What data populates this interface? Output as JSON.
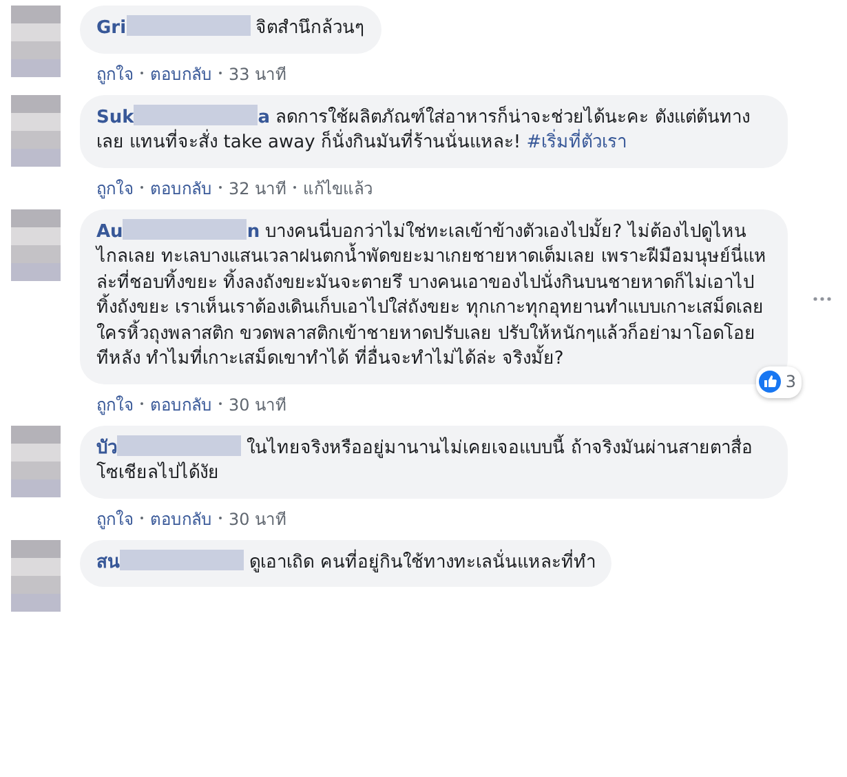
{
  "comments": [
    {
      "name": "Gri",
      "text": "จิตสำนึกล้วนๆ",
      "meta": [
        "ถูกใจ",
        "ตอบกลับ",
        "33 นาที"
      ]
    },
    {
      "name": "Suk",
      "name_end": "a",
      "text": "ลดการใช้ผลิตภัณฑ์ใส่อาหารก็น่าจะช่วยได้นะคะ ตังแต่ต้นทางเลย แทนที่จะสั่ง take away ก็นั่งกินมันที่ร้านนั่นแหละ!",
      "hashtag": "#เริ่มที่ตัวเรา",
      "meta": [
        "ถูกใจ",
        "ตอบกลับ",
        "32 นาที",
        "แก้ไขแล้ว"
      ]
    },
    {
      "name": "Au",
      "name_end": "n",
      "text": "บางคนนี่บอกว่าไม่ใช่ทะเลเข้าข้างตัวเองไปมั้ย? ไม่ต้องไปดูไหนไกลเลย ทะเลบางแสนเวลาฝนตกน้ำพัดขยะมาเกยชายหาดเต็มเลย เพราะฝีมือมนุษย์นี่แหล่ะที่ชอบทิ้งขยะ ทิ้งลงถังขยะมันจะตายรึ บางคนเอาของไปนั่งกินบนชายหาดก็ไม่เอาไปทิ้งถังขยะ เราเห็นเราต้องเดินเก็บเอาไปใส่ถังขยะ ทุกเกาะทุกอุทยานทำแบบเกาะเสม็ดเลย ใครหิ้วถุงพลาสติก ขวดพลาสติกเข้าชายหาดปรับเลย ปรับให้หนักๆแล้วก็อย่ามาโอดโอยทีหลัง ทำไมที่เกาะเสม็ดเขาทำได้ ที่อื่นจะทำไม่ได้ล่ะ จริงมั้ย?",
      "reactions": "3",
      "menu": true,
      "meta": [
        "ถูกใจ",
        "ตอบกลับ",
        "30 นาที"
      ]
    },
    {
      "name": "บัว",
      "text": "ในไทยจริงหรืออยู่มานานไม่เคยเจอแบบนี้ ถ้าจริงมันผ่านสายตาสื่อโซเชียลไปได้งัย",
      "meta": [
        "ถูกใจ",
        "ตอบกลับ",
        "30 นาที"
      ]
    },
    {
      "name": "สน",
      "text": "ดูเอาเถิด คนที่อยู่กินใช้ทางทะเลนั่นแหละที่ทำ"
    }
  ]
}
